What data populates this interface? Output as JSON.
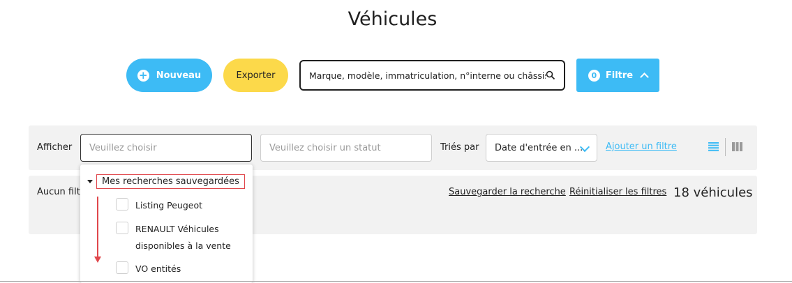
{
  "page": {
    "title": "Véhicules"
  },
  "toolbar": {
    "new_label": "Nouveau",
    "export_label": "Exporter",
    "search_placeholder": "Marque, modèle, immatriculation, n°interne ou châssis",
    "filter_count": "0",
    "filter_label": "Filtre"
  },
  "filters": {
    "show_label": "Afficher",
    "show_placeholder": "Veuillez choisir",
    "status_placeholder": "Veuillez choisir un statut",
    "sort_label": "Triés par",
    "sort_value": "Date d'entrée en ...",
    "add_filter_link": "Ajouter un filtre"
  },
  "results": {
    "no_filter_text": "Aucun filtr",
    "save_search_link": "Sauvegarder la recherche",
    "reset_filters_link": "Réinitialiser les filtres",
    "count_text": "18 véhicules"
  },
  "dropdown": {
    "group_label": "Mes recherches sauvegardées",
    "options": [
      {
        "label": "Listing Peugeot"
      },
      {
        "label_line1": "RENAULT Véhicules",
        "label_line2": "disponibles à la vente"
      },
      {
        "label": "VO entités"
      }
    ]
  },
  "colors": {
    "primary": "#3dbbf5",
    "export": "#fcd94a",
    "annotation": "#e0474c"
  },
  "icons": [
    "plus-icon",
    "search-icon",
    "chevron-up-icon",
    "chevron-down-icon",
    "list-view-icon",
    "grid-view-icon",
    "caret-down-icon"
  ]
}
